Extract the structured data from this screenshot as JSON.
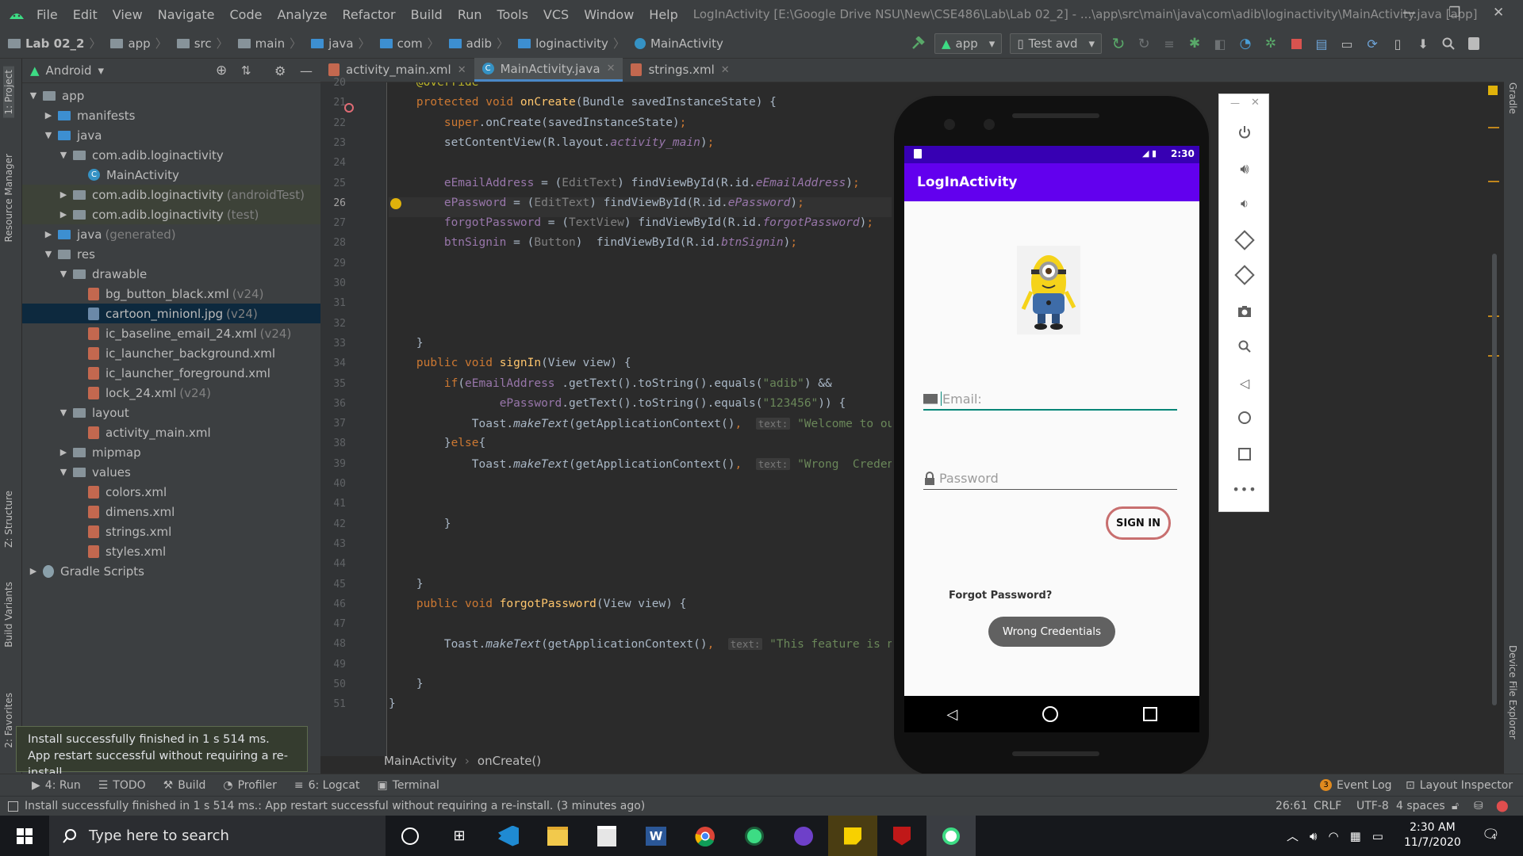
{
  "title_bar": {
    "menu": [
      "File",
      "Edit",
      "View",
      "Navigate",
      "Code",
      "Analyze",
      "Refactor",
      "Build",
      "Run",
      "Tools",
      "VCS",
      "Window",
      "Help"
    ],
    "window_title": "LogInActivity [E:\\Google Drive NSU\\New\\CSE486\\Lab\\Lab 02_2] - ...\\app\\src\\main\\java\\com\\adib\\loginactivity\\MainActivity.java [app]"
  },
  "breadcrumb": [
    "Lab 02_2",
    "app",
    "src",
    "main",
    "java",
    "com",
    "adib",
    "loginactivity",
    "MainActivity"
  ],
  "toolbar": {
    "run_config": "app",
    "device": "Test avd"
  },
  "project_panel": {
    "view_mode": "Android",
    "rows": [
      {
        "label": "app",
        "muted": "",
        "indent": 0,
        "arrow": "▼",
        "icon": "folder",
        "sel": false
      },
      {
        "label": "manifests",
        "muted": "",
        "indent": 1,
        "arrow": "▶",
        "icon": "folder-blue",
        "sel": false
      },
      {
        "label": "java",
        "muted": "",
        "indent": 1,
        "arrow": "▼",
        "icon": "folder-blue",
        "sel": false
      },
      {
        "label": "com.adib.loginactivity",
        "muted": "",
        "indent": 2,
        "arrow": "▼",
        "icon": "folder",
        "sel": false
      },
      {
        "label": "MainActivity",
        "muted": "",
        "indent": 3,
        "arrow": "",
        "icon": "class",
        "sel": false
      },
      {
        "label": "com.adib.loginactivity",
        "muted": "(androidTest)",
        "indent": 2,
        "arrow": "▶",
        "icon": "folder",
        "sel": false
      },
      {
        "label": "com.adib.loginactivity",
        "muted": "(test)",
        "indent": 2,
        "arrow": "▶",
        "icon": "folder",
        "sel": false
      },
      {
        "label": "java",
        "muted": "(generated)",
        "indent": 1,
        "arrow": "▶",
        "icon": "folder-blue",
        "sel": false
      },
      {
        "label": "res",
        "muted": "",
        "indent": 1,
        "arrow": "▼",
        "icon": "folder",
        "sel": false
      },
      {
        "label": "drawable",
        "muted": "",
        "indent": 2,
        "arrow": "▼",
        "icon": "folder",
        "sel": false
      },
      {
        "label": "bg_button_black.xml",
        "muted": "(v24)",
        "indent": 3,
        "arrow": "",
        "icon": "xml",
        "sel": false
      },
      {
        "label": "cartoon_minionl.jpg",
        "muted": "(v24)",
        "indent": 3,
        "arrow": "",
        "icon": "image",
        "sel": true
      },
      {
        "label": "ic_baseline_email_24.xml",
        "muted": "(v24)",
        "indent": 3,
        "arrow": "",
        "icon": "xml",
        "sel": false
      },
      {
        "label": "ic_launcher_background.xml",
        "muted": "",
        "indent": 3,
        "arrow": "",
        "icon": "xml",
        "sel": false
      },
      {
        "label": "ic_launcher_foreground.xml",
        "muted": "",
        "indent": 3,
        "arrow": "",
        "icon": "xml",
        "sel": false
      },
      {
        "label": "lock_24.xml",
        "muted": "(v24)",
        "indent": 3,
        "arrow": "",
        "icon": "xml",
        "sel": false
      },
      {
        "label": "layout",
        "muted": "",
        "indent": 2,
        "arrow": "▼",
        "icon": "folder",
        "sel": false
      },
      {
        "label": "activity_main.xml",
        "muted": "",
        "indent": 3,
        "arrow": "",
        "icon": "xml",
        "sel": false
      },
      {
        "label": "mipmap",
        "muted": "",
        "indent": 2,
        "arrow": "▶",
        "icon": "folder",
        "sel": false
      },
      {
        "label": "values",
        "muted": "",
        "indent": 2,
        "arrow": "▼",
        "icon": "folder",
        "sel": false
      },
      {
        "label": "colors.xml",
        "muted": "",
        "indent": 3,
        "arrow": "",
        "icon": "xml",
        "sel": false
      },
      {
        "label": "dimens.xml",
        "muted": "",
        "indent": 3,
        "arrow": "",
        "icon": "xml",
        "sel": false
      },
      {
        "label": "strings.xml",
        "muted": "",
        "indent": 3,
        "arrow": "",
        "icon": "xml",
        "sel": false
      },
      {
        "label": "styles.xml",
        "muted": "",
        "indent": 3,
        "arrow": "",
        "icon": "xml",
        "sel": false
      },
      {
        "label": "Gradle Scripts",
        "muted": "",
        "indent": 0,
        "arrow": "▶",
        "icon": "gradle",
        "sel": false
      }
    ]
  },
  "left_strip": [
    "1: Project",
    "Resource Manager",
    "Z: Structure",
    "Build Variants",
    "2: Favorites"
  ],
  "right_strip": [
    "Gradle",
    "Device File Explorer"
  ],
  "editor_tabs": [
    {
      "label": "activity_main.xml",
      "active": false
    },
    {
      "label": "MainActivity.java",
      "active": true
    },
    {
      "label": "strings.xml",
      "active": false
    }
  ],
  "code_lines": [
    {
      "n": "20",
      "html": "    <span class=\"an\">@Override</span>"
    },
    {
      "n": "21",
      "html": "    <span class=\"kw\">protected void </span><span class=\"fn\">onCreate</span>(Bundle savedInstanceState) {"
    },
    {
      "n": "22",
      "html": "        <span class=\"kw\">super</span>.onCreate(savedInstanceState)<span class=\"kw\">;</span>"
    },
    {
      "n": "23",
      "html": "        setContentView(R.layout.<span class=\"it\">activity_main</span>)<span class=\"kw\">;</span>"
    },
    {
      "n": "24",
      "html": ""
    },
    {
      "n": "25",
      "html": "        <span class=\"it\" style=\"font-style:normal\">eEmailAddress</span> = (<span style=\"color:#808080\">EditText</span>) findViewById(R.id.<span class=\"it\">eEmailAddress</span>)<span class=\"kw\">;</span>"
    },
    {
      "n": "26",
      "html": "        <span class=\"it\" style=\"font-style:normal\">ePassword</span> = (<span style=\"color:#808080\">EditText</span>) findViewById(R.id.<span class=\"it\">ePassword</span>)<span class=\"kw\">;</span>"
    },
    {
      "n": "27",
      "html": "        <span class=\"it\" style=\"font-style:normal\">forgotPassword</span> = (<span style=\"color:#808080\">TextView</span>) findViewById(R.id.<span class=\"it\">forgotPassword</span>)<span class=\"kw\">;</span>"
    },
    {
      "n": "28",
      "html": "        <span class=\"it\" style=\"font-style:normal\">btnSignin</span> = (<span style=\"color:#808080\">Button</span>)  findViewById(R.id.<span class=\"it\">btnSignin</span>)<span class=\"kw\">;</span>"
    },
    {
      "n": "29",
      "html": ""
    },
    {
      "n": "30",
      "html": ""
    },
    {
      "n": "31",
      "html": ""
    },
    {
      "n": "32",
      "html": ""
    },
    {
      "n": "33",
      "html": "    }"
    },
    {
      "n": "34",
      "html": "    <span class=\"kw\">public void </span><span class=\"fn\">signIn</span>(View view) {"
    },
    {
      "n": "35",
      "html": "        <span class=\"kw\">if</span>(<span class=\"it\" style=\"font-style:normal\">eEmailAddress</span> .getText().toString().equals(<span class=\"st\">\"adib\"</span>) &amp;&amp;"
    },
    {
      "n": "36",
      "html": "                <span class=\"it\" style=\"font-style:normal\">ePassword</span>.getText().toString().equals(<span class=\"st\">\"123456\"</span>)) {"
    },
    {
      "n": "37",
      "html": "            Toast.<span class=\"mi\">makeText</span>(getApplicationContext()<span class=\"kw\">,</span>  <span class=\"hint\">text:</span> <span class=\"st\">\"Welcome to our</span>"
    },
    {
      "n": "38",
      "html": "        }<span class=\"kw\">else</span>{"
    },
    {
      "n": "39",
      "html": "            Toast.<span class=\"mi\">makeText</span>(getApplicationContext()<span class=\"kw\">,</span>  <span class=\"hint\">text:</span> <span class=\"st\">\"Wrong  Credenti</span>"
    },
    {
      "n": "40",
      "html": ""
    },
    {
      "n": "41",
      "html": ""
    },
    {
      "n": "42",
      "html": "        }"
    },
    {
      "n": "43",
      "html": ""
    },
    {
      "n": "44",
      "html": ""
    },
    {
      "n": "45",
      "html": "    }"
    },
    {
      "n": "46",
      "html": "    <span class=\"kw\">public void </span><span class=\"fn\">forgotPassword</span>(View view) {"
    },
    {
      "n": "47",
      "html": ""
    },
    {
      "n": "48",
      "html": "        Toast.<span class=\"mi\">makeText</span>(getApplicationContext()<span class=\"kw\">,</span>  <span class=\"hint\">text:</span> <span class=\"st\">\"This feature is no</span>"
    },
    {
      "n": "49",
      "html": ""
    },
    {
      "n": "50",
      "html": "    }"
    },
    {
      "n": "51",
      "html": "}"
    }
  ],
  "editor_breadcrumb": [
    "MainActivity",
    "onCreate()"
  ],
  "phone": {
    "status_time": "2:30",
    "app_title": "LogInActivity",
    "email_placeholder": "Email:",
    "password_placeholder": "Password",
    "sign_in_label": "SIGN IN",
    "forgot_label": "Forgot Password?",
    "toast": "Wrong  Credentials"
  },
  "tool_windows": {
    "left": [
      "4: Run",
      "TODO",
      "Build",
      "Profiler",
      "6: Logcat",
      "Terminal"
    ],
    "right": [
      "Event Log",
      "Layout Inspector"
    ],
    "event_count": "3"
  },
  "notification": {
    "line1": "Install successfully finished in 1 s 514 ms.",
    "line2": "App restart successful without requiring a re-install."
  },
  "status_bar": {
    "message": "Install successfully finished in 1 s 514 ms.: App restart successful without requiring a re-install. (3 minutes ago)",
    "position": "26:61",
    "line_sep": "CRLF",
    "encoding": "UTF-8",
    "indent": "4 spaces"
  },
  "taskbar": {
    "search_placeholder": "Type here to search",
    "time": "2:30 AM",
    "date": "11/7/2020",
    "notif_count": "4"
  },
  "colors": {
    "accent": "#6200ee",
    "status": "#3700b3",
    "ide_bg": "#2b2b2b"
  }
}
